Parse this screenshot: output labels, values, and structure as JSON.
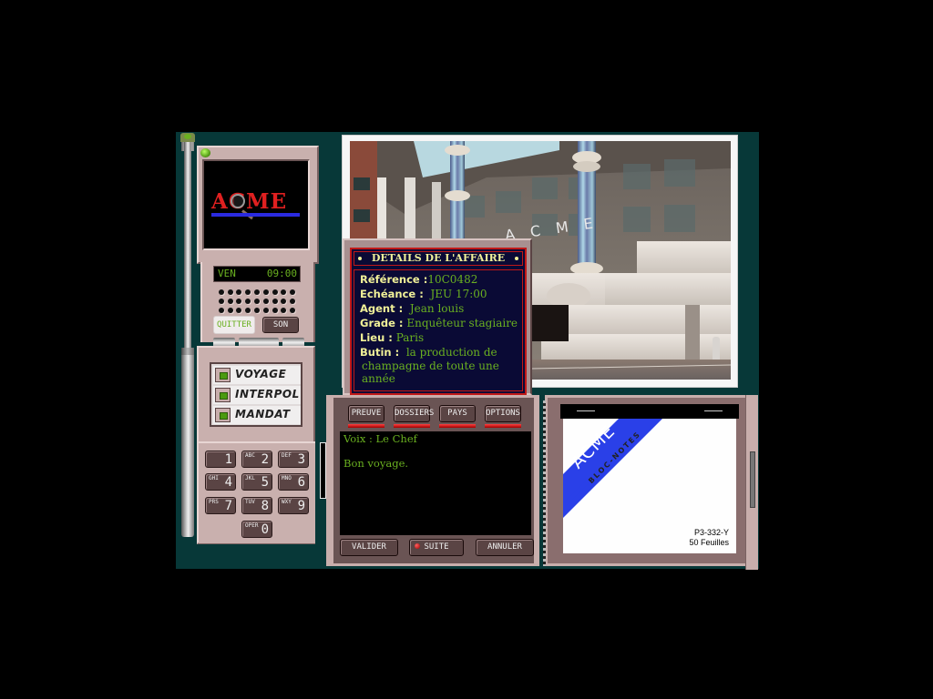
{
  "phone": {
    "logo_text": "ACME",
    "lcd_day": "VEN",
    "lcd_time": "09:00",
    "quit_label": "QUITTER",
    "sound_label": "SON",
    "modes": [
      {
        "label": "VOYAGE"
      },
      {
        "label": "INTERPOL"
      },
      {
        "label": "MANDAT"
      }
    ],
    "keypad": [
      {
        "sub": "",
        "num": "1"
      },
      {
        "sub": "ABC",
        "num": "2"
      },
      {
        "sub": "DEF",
        "num": "3"
      },
      {
        "sub": "GHI",
        "num": "4"
      },
      {
        "sub": "JKL",
        "num": "5"
      },
      {
        "sub": "MNO",
        "num": "6"
      },
      {
        "sub": "PRS",
        "num": "7"
      },
      {
        "sub": "TUV",
        "num": "8"
      },
      {
        "sub": "WXY",
        "num": "9"
      },
      {
        "sub": "OPER",
        "num": "0"
      }
    ]
  },
  "scene": {
    "description": "ACME headquarters building exterior",
    "sign_text": "A C M E"
  },
  "case_details": {
    "title": "DETAILS DE L'AFFAIRE",
    "fields": [
      {
        "key": "Référence :",
        "value": "10C0482"
      },
      {
        "key": "Echéance :",
        "value": "JEU 17:00"
      },
      {
        "key": "Agent :",
        "value": "Jean louis"
      },
      {
        "key": "Grade :",
        "value": "Enquêteur stagiaire"
      },
      {
        "key": "Lieu :",
        "value": "Paris"
      },
      {
        "key": "Butin :",
        "value": "la production de"
      }
    ],
    "butin_continued": [
      "champagne de toute une",
      "année"
    ]
  },
  "console": {
    "tabs": [
      {
        "label": "PREUVE"
      },
      {
        "label": "DOSSIERS"
      },
      {
        "label": "PAYS"
      },
      {
        "label": "OPTIONS"
      }
    ],
    "message_speaker": "Voix : Le Chef",
    "message_text": "Bon voyage.",
    "actions": [
      {
        "label": "VALIDER"
      },
      {
        "label": "SUITE"
      },
      {
        "label": "ANNULER"
      }
    ]
  },
  "notepad": {
    "brand": "ACME",
    "subtitle": "BLOC-NOTES",
    "ref_code": "P3-332-Y",
    "sheets": "50 Feuilles"
  },
  "colors": {
    "background": "#073838",
    "lcd_green": "#6ab020",
    "details_label": "#f0f098",
    "details_bg": "#0a0a35",
    "details_border": "#c01818",
    "notepad_blue": "#2a40e8"
  }
}
